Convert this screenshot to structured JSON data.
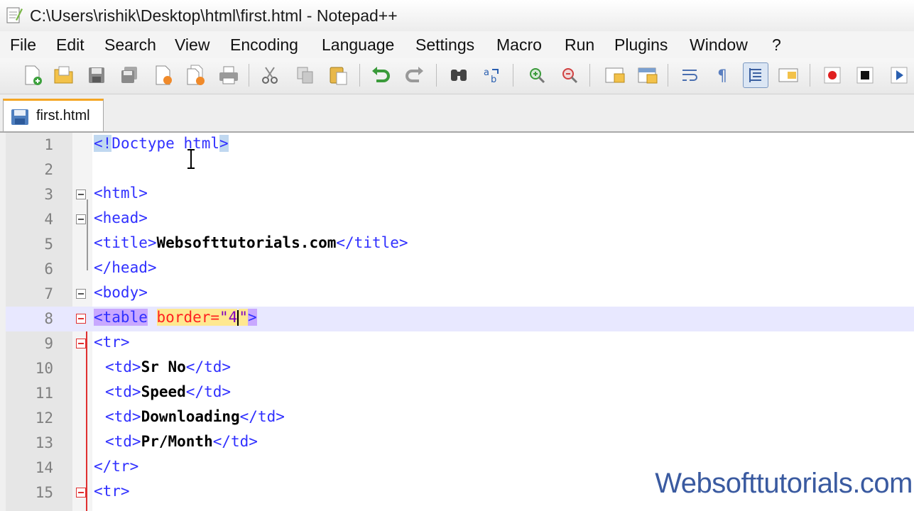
{
  "window": {
    "title": "C:\\Users\\rishik\\Desktop\\html\\first.html - Notepad++"
  },
  "menu": [
    {
      "label": "File"
    },
    {
      "label": "Edit"
    },
    {
      "label": "Search"
    },
    {
      "label": "View"
    },
    {
      "label": "Encoding"
    },
    {
      "label": "Language"
    },
    {
      "label": "Settings"
    },
    {
      "label": "Macro"
    },
    {
      "label": "Run"
    },
    {
      "label": "Plugins"
    },
    {
      "label": "Window"
    },
    {
      "label": "?"
    }
  ],
  "toolbar": {
    "icons": [
      "new-file-icon",
      "open-file-icon",
      "save-icon",
      "save-all-icon",
      "close-icon",
      "close-all-icon",
      "print-icon",
      "cut-icon",
      "copy-icon",
      "paste-icon",
      "undo-icon",
      "redo-icon",
      "find-icon",
      "replace-icon",
      "zoom-in-icon",
      "zoom-out-icon",
      "sync-vertical-icon",
      "sync-horizontal-icon",
      "word-wrap-icon",
      "show-all-chars-icon",
      "indent-guide-icon",
      "language-icon",
      "record-macro-icon",
      "stop-macro-icon",
      "play-macro-icon"
    ]
  },
  "tabs": [
    {
      "label": "first.html"
    }
  ],
  "editor": {
    "current_line": 8,
    "lines": [
      {
        "n": "1"
      },
      {
        "n": "2"
      },
      {
        "n": "3"
      },
      {
        "n": "4"
      },
      {
        "n": "5"
      },
      {
        "n": "6"
      },
      {
        "n": "7"
      },
      {
        "n": "8"
      },
      {
        "n": "9"
      },
      {
        "n": "10"
      },
      {
        "n": "11"
      },
      {
        "n": "12"
      },
      {
        "n": "13"
      },
      {
        "n": "14"
      },
      {
        "n": "15"
      }
    ],
    "code": {
      "l1_open": "<!",
      "l1_name": "Doctype html",
      "l1_close": ">",
      "l3": "<html>",
      "l4": "<head>",
      "l5_open": "<title>",
      "l5_text": "Websofttutorials.com",
      "l5_close": "</title>",
      "l6": "</head>",
      "l7": "<body>",
      "l8_open": "<table",
      "l8_attr": "border=",
      "l8_val_a": "\"4",
      "l8_val_b": "\"",
      "l8_close": ">",
      "l9": "<tr>",
      "l10_open": "<td>",
      "l10_text": "Sr No",
      "l10_close": "</td>",
      "l11_open": "<td>",
      "l11_text": "Speed",
      "l11_close": "</td>",
      "l12_open": "<td>",
      "l12_text": "Downloading",
      "l12_close": "</td>",
      "l13_open": "<td>",
      "l13_text": "Pr/Month",
      "l13_close": "</td>",
      "l14": "</tr>",
      "l15": "<tr>"
    }
  },
  "watermark": "Websofttutorials.com"
}
